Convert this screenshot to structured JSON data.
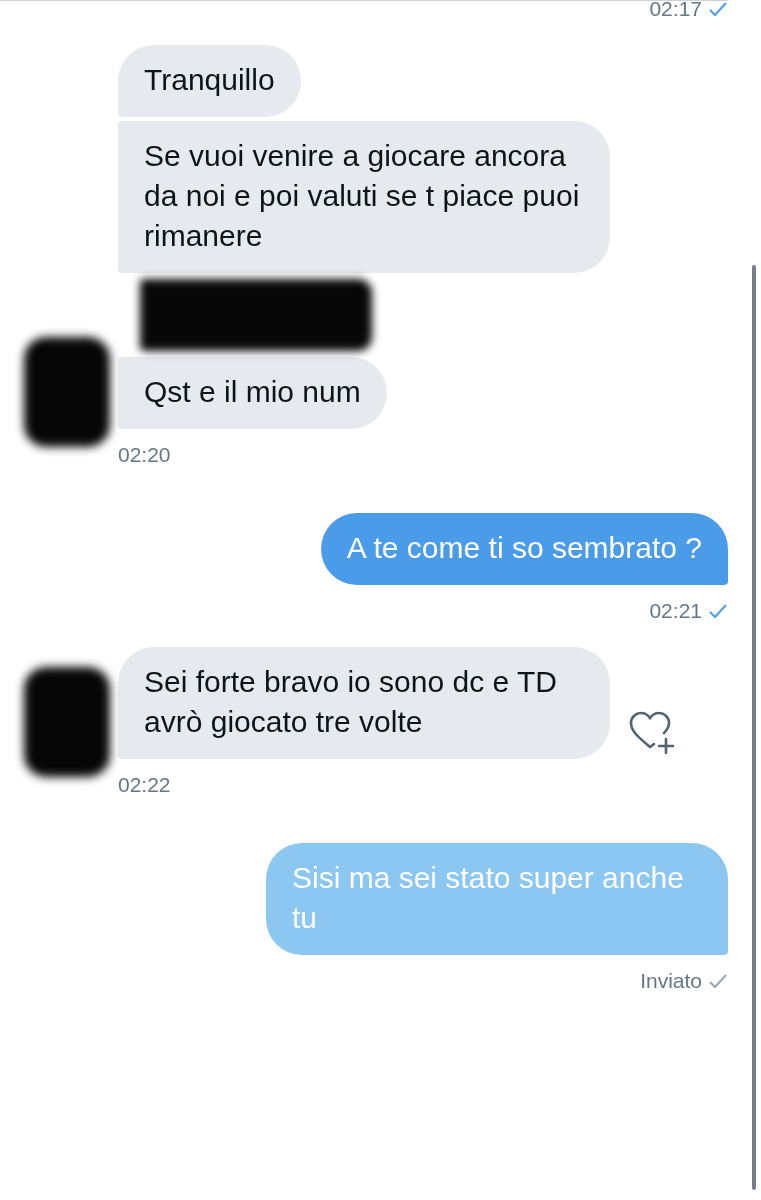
{
  "top_status": {
    "time": "02:17",
    "read": true
  },
  "groups": [
    {
      "kind": "received",
      "bubbles": [
        {
          "kind": "text",
          "text": "Tranquillo"
        },
        {
          "kind": "text",
          "text": "Se vuoi venire a giocare ancora da noi e poi valuti se t piace puoi rimanere"
        },
        {
          "kind": "redacted"
        },
        {
          "kind": "text",
          "text": "Qst e il mio num"
        }
      ],
      "time": "02:20",
      "like_button": false
    },
    {
      "kind": "sent",
      "bubbles": [
        {
          "kind": "text",
          "text": "A te come ti so sembrato ?"
        }
      ],
      "time": "02:21",
      "read": true
    },
    {
      "kind": "received",
      "bubbles": [
        {
          "kind": "text",
          "text": "Sei forte bravo io sono dc e TD avrò giocato tre volte"
        }
      ],
      "time": "02:22",
      "like_button": true
    },
    {
      "kind": "sent",
      "bubbles": [
        {
          "kind": "text",
          "text": "Sisi ma sei stato super anche tu"
        }
      ],
      "time": "Inviato",
      "read": false
    }
  ]
}
